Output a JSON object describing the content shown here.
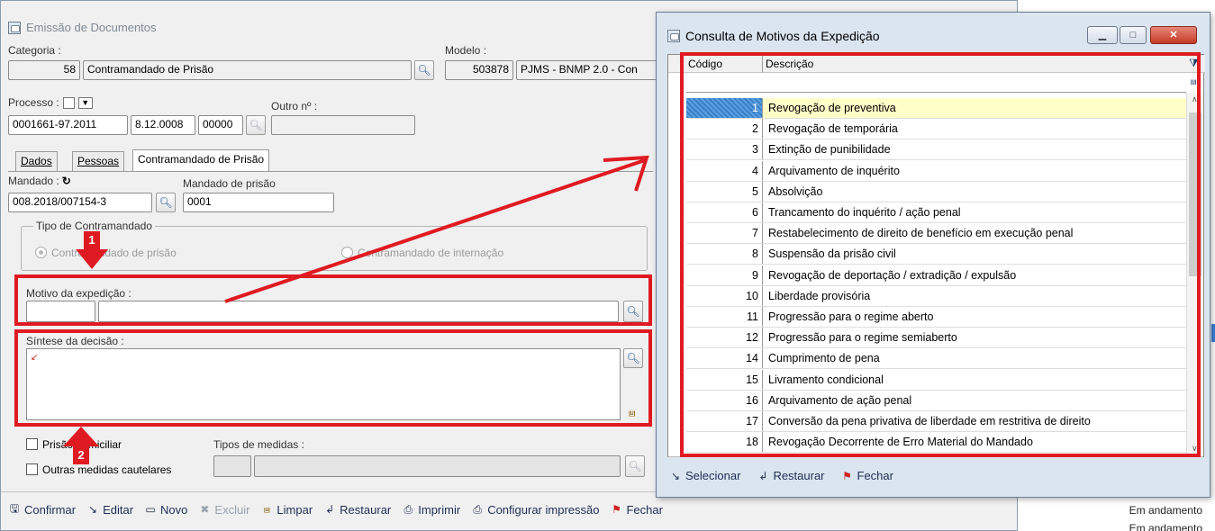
{
  "main_window": {
    "title": "Emissão de Documentos",
    "categoria": {
      "label": "Categoria :",
      "code": "58",
      "name": "Contramandado de Prisão"
    },
    "modelo": {
      "label": "Modelo :",
      "code": "503878",
      "name": "PJMS - BNMP 2.0 - Con"
    },
    "processo": {
      "label": "Processo :",
      "part1": "0001661-97.2011",
      "part2": "8.12.0008",
      "part3": "00000"
    },
    "outro": {
      "label": "Outro nº :",
      "value": ""
    },
    "tabs": [
      {
        "label": "Dados",
        "underline": "D"
      },
      {
        "label": "Pessoas",
        "underline": "P"
      },
      {
        "label": "Contramandado de Prisão"
      }
    ],
    "mandado": {
      "label": "Mandado :",
      "value": "008.2018/007154-3"
    },
    "mandado_prisao": {
      "label": "Mandado de prisão",
      "value": "0001"
    },
    "tipo_group": {
      "legend": "Tipo de Contramandado",
      "option1": "Contramandado de prisão",
      "option2": "Contramandado de internação"
    },
    "motivo": {
      "label": "Motivo da expedição :",
      "code": "",
      "desc": ""
    },
    "sintese": {
      "label": "Síntese da decisão :"
    },
    "prisao_domiciliar": "Prisão domiciliar",
    "outras_medidas": "Outras medidas cautelares",
    "tipos_medidas": {
      "label": "Tipos de medidas :"
    },
    "toolbar": {
      "confirmar": "Confirmar",
      "editar": "Editar",
      "novo": "Novo",
      "excluir": "Excluir",
      "limpar": "Limpar",
      "restaurar": "Restaurar",
      "imprimir": "Imprimir",
      "configurar": "Configurar impressão",
      "fechar": "Fechar"
    }
  },
  "markers": {
    "one": "1",
    "two": "2"
  },
  "background_status": [
    "Em andamento",
    "Em andamento"
  ],
  "dialog": {
    "title": "Consulta de Motivos da Expedição",
    "col_code": "Código",
    "col_desc": "Descrição",
    "rows": [
      {
        "code": "1",
        "desc": "Revogação de preventiva"
      },
      {
        "code": "2",
        "desc": "Revogação de temporária"
      },
      {
        "code": "3",
        "desc": "Extinção de punibilidade"
      },
      {
        "code": "4",
        "desc": "Arquivamento de inquérito"
      },
      {
        "code": "5",
        "desc": "Absolvição"
      },
      {
        "code": "6",
        "desc": "Trancamento do inquérito / ação penal"
      },
      {
        "code": "7",
        "desc": "Restabelecimento de direito de benefício em execução penal"
      },
      {
        "code": "8",
        "desc": "Suspensão da prisão civil"
      },
      {
        "code": "9",
        "desc": "Revogação de deportação / extradição / expulsão"
      },
      {
        "code": "10",
        "desc": "Liberdade provisória"
      },
      {
        "code": "11",
        "desc": "Progressão para o regime aberto"
      },
      {
        "code": "12",
        "desc": "Progressão para o regime semiaberto"
      },
      {
        "code": "14",
        "desc": "Cumprimento de pena"
      },
      {
        "code": "15",
        "desc": "Livramento condicional"
      },
      {
        "code": "16",
        "desc": "Arquivamento de ação penal"
      },
      {
        "code": "17",
        "desc": "Conversão da pena privativa de liberdade em restritiva de direito"
      },
      {
        "code": "18",
        "desc": "Revogação Decorrente de Erro Material do Mandado"
      }
    ],
    "toolbar": {
      "selecionar": "Selecionar",
      "restaurar": "Restaurar",
      "fechar": "Fechar"
    }
  },
  "colors": {
    "highlight_red": "#e01a22",
    "selected_row": "#fffdc8"
  }
}
